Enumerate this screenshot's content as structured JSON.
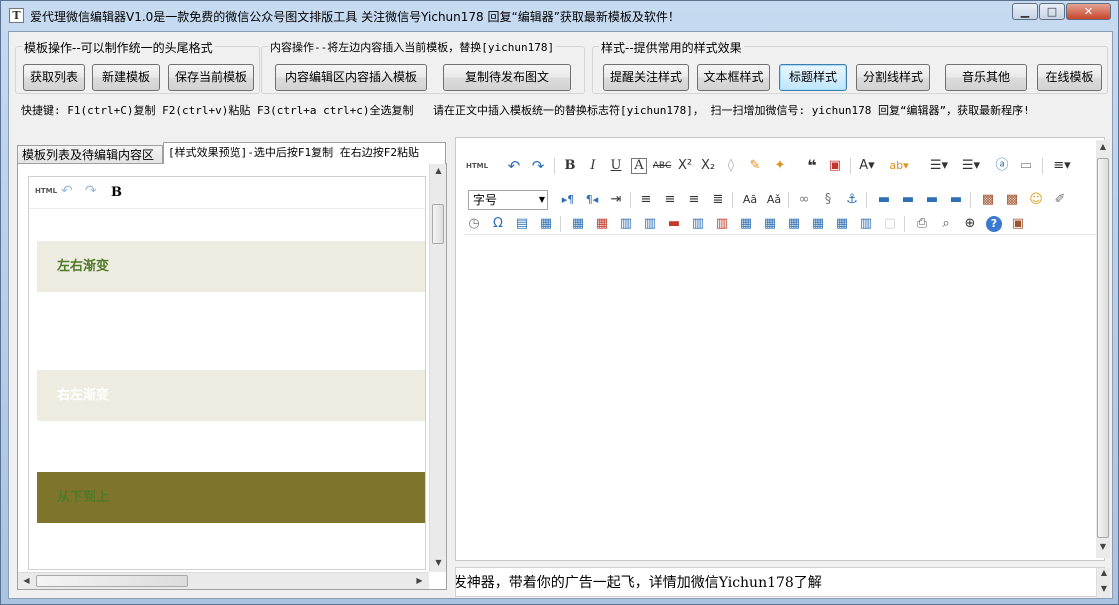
{
  "window": {
    "title": "爱代理微信编辑器V1.0是一款免费的微信公众号图文排版工具 关注微信号Yichun178 回复“编辑器”获取最新模板及软件！",
    "icon": "T",
    "controls": {
      "minimize": "▁",
      "maximize": "□",
      "close": "✕"
    }
  },
  "groups": {
    "template_ops": {
      "label": "模板操作--可以制作统一的头尾格式",
      "buttons": [
        "获取列表",
        "新建模板",
        "保存当前模板"
      ]
    },
    "content_ops": {
      "label": "内容操作--将左边内容插入当前模板，替换[yichun178]",
      "buttons": [
        "内容编辑区内容插入模板",
        "复制待发布图文"
      ]
    },
    "style_ops": {
      "label": "样式--提供常用的样式效果",
      "buttons": [
        "提醒关注样式",
        "文本框样式",
        "标题样式",
        "分割线样式",
        "音乐其他",
        "在线模板"
      ],
      "active_index": 2
    }
  },
  "shortcuts": {
    "text1": "快捷键: F1(ctrl+C)复制  F2(ctrl+v)粘贴 F3(ctrl+a ctrl+c)全选复制",
    "text2": "请在正文中插入模板统一的替换标志符[yichun178]， 扫一扫增加微信号: yichun178 回复“编辑器”，获取最新程序!"
  },
  "tabs": [
    {
      "label": "模板列表及待编辑内容区",
      "selected": false
    },
    {
      "label": "[样式效果预览]-选中后按F1复制 在右边按F2粘贴",
      "selected": true
    }
  ],
  "preview": {
    "toolbar": {
      "html": "HTML",
      "undo": "↶",
      "redo": "↷",
      "bold": "B"
    },
    "bands": [
      {
        "text": "左右渐变",
        "bg": "#eeece1",
        "color": "#4f7a28"
      },
      {
        "text": "右左渐变",
        "bg": "#eeece1",
        "color": "#ffffff"
      },
      {
        "text": "从下到上",
        "bg": "#7f742c",
        "color": "#4f7a28"
      }
    ]
  },
  "editor": {
    "font_size_label": "字号",
    "row1_icons": [
      "html-source",
      "undo",
      "redo",
      "bold",
      "italic",
      "underline",
      "font-border",
      "strikethrough",
      "superscript",
      "subscript",
      "eraser",
      "format-brush",
      "auto-typeset",
      "blockquote",
      "paste-plain",
      "font-color",
      "highlight",
      "ordered-list",
      "unordered-list",
      "selectall",
      "clear-doc",
      "line-height"
    ],
    "ticker_text": "|发神器，带着你的广告一起飞，详情加微信Yichun178了解"
  },
  "colors": {
    "titlebar": "#c6daf0",
    "client": "#f0f0f0",
    "active_button": "#bee6fd",
    "icon_blue": "#2e6fb5",
    "icon_red": "#c0392b",
    "icon_orange": "#e09020"
  }
}
